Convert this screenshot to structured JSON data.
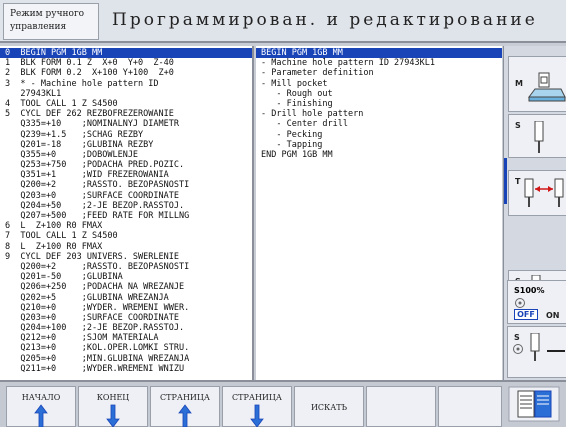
{
  "header": {
    "mode_line1": "Режим ручного",
    "mode_line2": "управления",
    "title": "Программирован. и редактирование"
  },
  "program": {
    "lines": [
      "0  BEGIN PGM 1GB MM",
      "1  BLK FORM 0.1 Z  X+0  Y+0  Z-40",
      "2  BLK FORM 0.2  X+100 Y+100  Z+0",
      "3  * - Machine hole pattern ID",
      "   27943KL1",
      "4  TOOL CALL 1 Z S4500",
      "5  CYCL DEF 262 REZBOFREZEROWANIE",
      "   Q335=+10    ;NOMINALNYJ DIAMETR",
      "   Q239=+1.5   ;SCHAG REZBY",
      "   Q201=-18    ;GLUBINA REZBY",
      "   Q355=+0     ;DOBOWLENJE",
      "   Q253=+750   ;PODACHA PRED.POZIC.",
      "   Q351=+1     ;WID FREZEROWANIA",
      "   Q200=+2     ;RASSTO. BEZOPASNOSTI",
      "   Q203=+0     ;SURFACE COORDINATE",
      "   Q204=+50    ;2-JE BEZOP.RASSTOJ.",
      "   Q207=+500   ;FEED RATE FOR MILLNG",
      "6  L  Z+100 R0 FMAX",
      "7  TOOL CALL 1 Z S4500",
      "8  L  Z+100 R0 FMAX",
      "9  CYCL DEF 203 UNIVERS. SWERLENIE",
      "   Q200=+2     ;RASSTO. BEZOPASNOSTI",
      "   Q201=-50    ;GLUBINA",
      "   Q206=+250   ;PODACHA NA WREZANJE",
      "   Q202=+5     ;GLUBINA WREZANJA",
      "   Q210=+0     ;WYDER. WREMENI WWER.",
      "   Q203=+0     ;SURFACE COORDINATE",
      "   Q204=+100   ;2-JE BEZOP.RASSTOJ.",
      "   Q212=+0     ;SJOM MATERIALA",
      "   Q213=+0     ;KOL.OPER.LOMKI STRU.",
      "   Q205=+0     ;MIN.GLUBINA WREZANJA",
      "   Q211=+0     ;WYDER.WREMENI WNIZU"
    ],
    "selected_index": 0
  },
  "structure": {
    "lines": [
      "BEGIN PGM 1GB MM",
      "- Machine hole pattern ID 27943KL1",
      "- Parameter definition",
      "- Mill pocket",
      "   - Rough out",
      "   - Finishing",
      "- Drill hole pattern",
      "   - Center drill",
      "   - Pecking",
      "   - Tapping",
      "END PGM 1GB MM"
    ],
    "selected_index": 0
  },
  "side_softkeys": {
    "m_label": "M",
    "s_label": "S",
    "t_label": "T",
    "s_plus_label": "S",
    "override_label": "S100%",
    "override_off": "OFF",
    "override_on": "ON",
    "s_minus_label": "S"
  },
  "bottom_softkeys": {
    "begin": "НАЧАЛО",
    "end": "КОНЕЦ",
    "page_up": "СТРАНИЦА",
    "page_down": "СТРАНИЦА",
    "search": "ИСКАТЬ"
  },
  "colors": {
    "selection": "#1844b8",
    "accent_red": "#d01818"
  }
}
